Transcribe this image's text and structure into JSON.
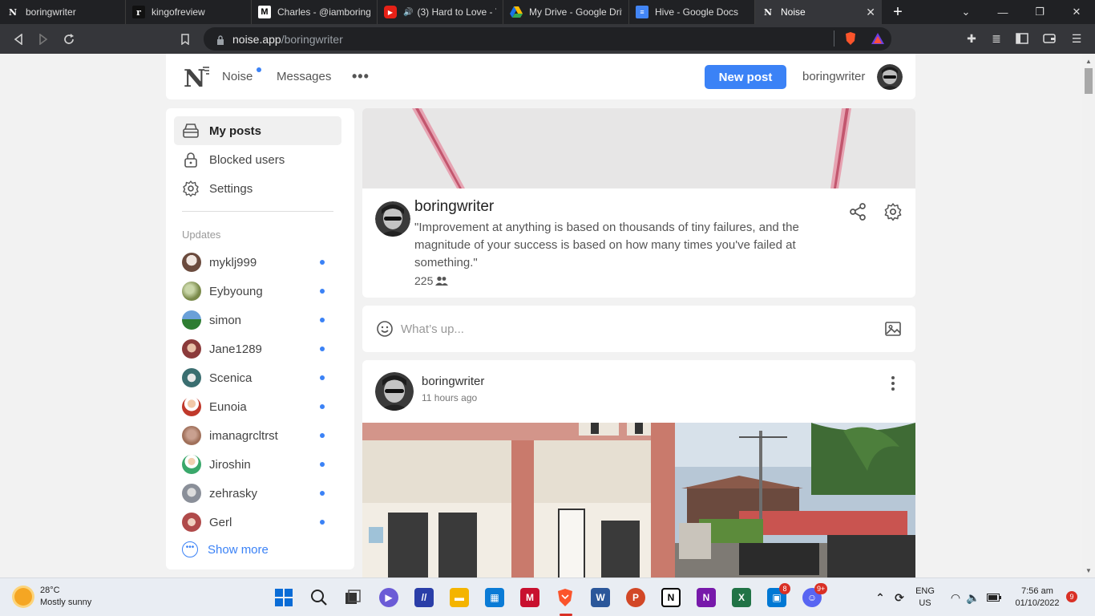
{
  "browser": {
    "tabs": [
      {
        "label": "boringwriter",
        "favicon": "noise-icon"
      },
      {
        "label": "kingofreview",
        "favicon": "r-icon"
      },
      {
        "label": "Charles - @iamboring",
        "favicon": "medium-icon"
      },
      {
        "label": "(3) Hard to Love - Y",
        "favicon": "youtube-icon"
      },
      {
        "label": "My Drive - Google Driv",
        "favicon": "drive-icon"
      },
      {
        "label": "Hive - Google Docs",
        "favicon": "docs-icon"
      },
      {
        "label": "Noise",
        "favicon": "noise-icon",
        "active": true
      }
    ],
    "url_host": "noise.app",
    "url_path": "/boringwriter"
  },
  "topnav": {
    "logo": "N",
    "noise_label": "Noise",
    "messages_label": "Messages",
    "more_label": "•••",
    "new_post_label": "New post",
    "username": "boringwriter"
  },
  "sidebar": {
    "items": [
      {
        "label": "My posts",
        "icon": "inbox-icon",
        "active": true
      },
      {
        "label": "Blocked users",
        "icon": "lock-icon"
      },
      {
        "label": "Settings",
        "icon": "gear-icon"
      }
    ],
    "updates_label": "Updates",
    "updates": [
      {
        "name": "myklj999",
        "color": "#6b4b3e"
      },
      {
        "name": "Eybyoung",
        "color": "#7a8a4a"
      },
      {
        "name": "simon",
        "color": "#2e7d32"
      },
      {
        "name": "Jane1289",
        "color": "#8b3a3a"
      },
      {
        "name": "Scenica",
        "color": "#3a6e70"
      },
      {
        "name": "Eunoia",
        "color": "#c0392b"
      },
      {
        "name": "imanagrcltrst",
        "color": "#a0705a"
      },
      {
        "name": "Jiroshin",
        "color": "#3aa86b"
      },
      {
        "name": "zehrasky",
        "color": "#8a8f99"
      },
      {
        "name": "Gerl",
        "color": "#b04a4a"
      }
    ],
    "show_more_label": "Show more"
  },
  "profile": {
    "name": "boringwriter",
    "bio": "\"Improvement at anything is based on thousands of tiny failures, and the magnitude of your success is based on how many times you've failed at something.\"",
    "followers": "225"
  },
  "composer": {
    "placeholder": "What’s up..."
  },
  "post": {
    "author": "boringwriter",
    "time": "11 hours ago"
  },
  "taskbar": {
    "temperature": "28°C",
    "weather": "Mostly sunny",
    "lang_top": "ENG",
    "lang_bottom": "US",
    "time": "7:56 am",
    "date": "01/10/2022",
    "notification_count": "9",
    "ppt_badge": "8",
    "discord_badge": "9+"
  },
  "colors": {
    "accent": "#3b82f6",
    "page_bg": "#f2f2f2"
  }
}
